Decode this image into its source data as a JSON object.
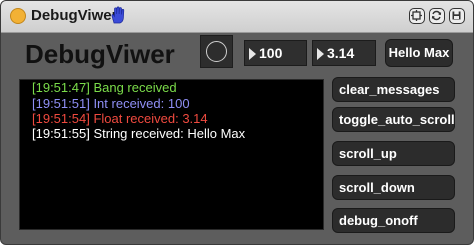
{
  "window": {
    "title": "DebugViwer"
  },
  "toolbar": {
    "icons": [
      "hand-icon",
      "presentation-mode-icon",
      "cycle-icon",
      "save-icon"
    ]
  },
  "header": {
    "app_title": "DebugViwer",
    "int_value": "100",
    "float_value": "3.14",
    "message_button": "Hello Max"
  },
  "console": {
    "lines": [
      {
        "text": "[19:51:47] Bang received",
        "color": "#7bdc4a"
      },
      {
        "text": "[19:51:51] Int received: 100",
        "color": "#8f8ff5"
      },
      {
        "text": "[19:51:54] Float received: 3.14",
        "color": "#f04a3f"
      },
      {
        "text": "[19:51:55] String received: Hello Max",
        "color": "#ffffff"
      }
    ]
  },
  "buttons": {
    "clear": "clear_messages",
    "toggle": "toggle_auto_scroll",
    "scroll_up": "scroll_up",
    "scroll_down": "scroll_down",
    "debug": "debug_onoff"
  },
  "colors": {
    "panel_bg": "#5d5d5d",
    "button_bg": "#2c2c2c",
    "title_dot": "#f2b135",
    "hand_icon": "#3b4bd8"
  }
}
